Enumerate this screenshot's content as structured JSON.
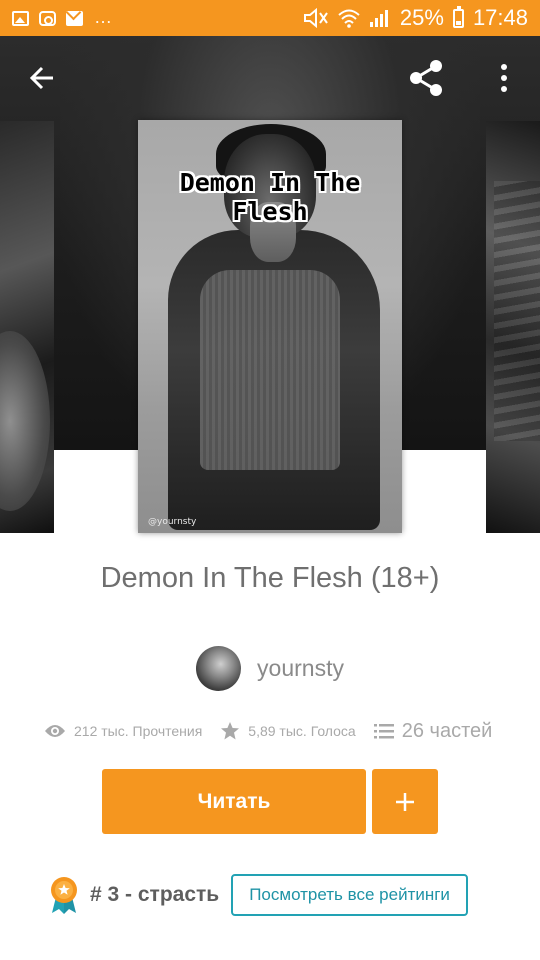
{
  "status_bar": {
    "battery_percent": "25%",
    "time": "17:48",
    "notification_icons": [
      "gallery-icon",
      "instagram-icon",
      "mail-icon"
    ],
    "notification_overflow": "..."
  },
  "toolbar": {
    "back_icon": "arrow-left-icon",
    "share_icon": "share-icon",
    "more_icon": "more-vert-icon"
  },
  "cover": {
    "title_art": "Demon In The Flesh",
    "credit": "@yournsty"
  },
  "story": {
    "title": "Demon In The Flesh (18+)",
    "author": "yournsty"
  },
  "stats": {
    "reads": "212 тыс. Прочтения",
    "votes": "5,89 тыс. Голоса",
    "parts": "26 частей"
  },
  "actions": {
    "read_label": "Читать",
    "add_label": "+"
  },
  "ranking": {
    "rank_label": "# 3 - страсть",
    "view_all_label": "Посмотреть все рейтинги"
  },
  "colors": {
    "accent": "#f5961f",
    "link": "#22a2b4",
    "title_gray": "#6f6f6f"
  }
}
